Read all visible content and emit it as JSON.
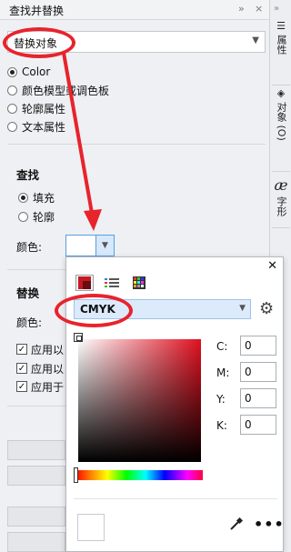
{
  "window": {
    "title": "查找并替换",
    "controls": [
      "»",
      "×"
    ]
  },
  "scope": {
    "selected": "替换对象"
  },
  "replace_type": {
    "options": [
      {
        "label": "Color",
        "selected": true
      },
      {
        "label": "颜色模型或调色板",
        "selected": false
      },
      {
        "label": "轮廓属性",
        "selected": false
      },
      {
        "label": "文本属性",
        "selected": false
      }
    ]
  },
  "find": {
    "title": "查找",
    "targets": [
      {
        "label": "填充",
        "selected": true
      },
      {
        "label": "轮廓",
        "selected": false
      }
    ],
    "color_label": "颜色:"
  },
  "replace": {
    "title": "替换",
    "color_label": "颜色:",
    "apply_options": [
      {
        "label": "应用以",
        "checked": true
      },
      {
        "label": "应用以",
        "checked": true
      },
      {
        "label": "应用于",
        "checked": true
      }
    ]
  },
  "dock_tabs": [
    {
      "label": "属性",
      "icon": "properties-icon"
    },
    {
      "label": "对象 (O)",
      "icon": "layers-icon"
    },
    {
      "label": "字形",
      "icon": "glyph-icon"
    }
  ],
  "color_popup": {
    "close": "✕",
    "color_model": "CMYK",
    "channels": [
      {
        "label": "C:",
        "value": "0"
      },
      {
        "label": "M:",
        "value": "0"
      },
      {
        "label": "Y:",
        "value": "0"
      },
      {
        "label": "K:",
        "value": "0"
      }
    ],
    "more": "•••"
  },
  "colors": {
    "annotation": "#e8232c",
    "accent_blue": "#5c9de0"
  }
}
